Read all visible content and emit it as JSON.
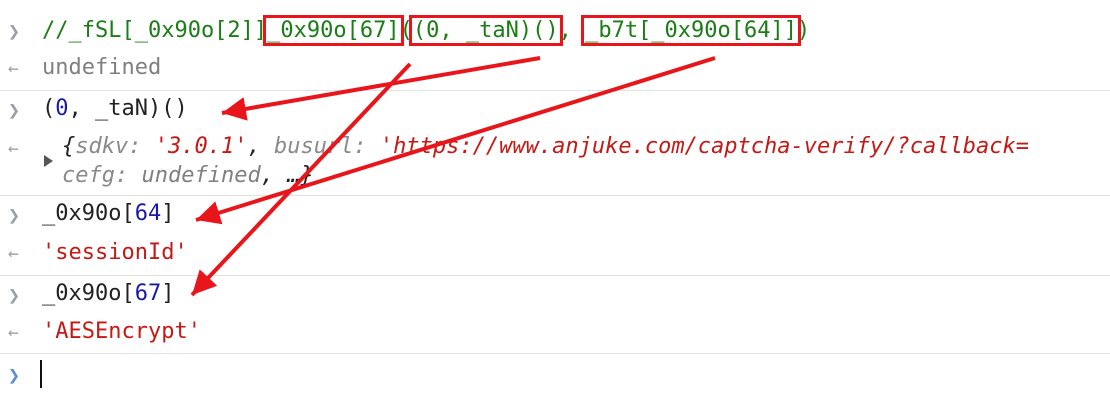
{
  "console": {
    "line1": {
      "comment_start": "//_fSL[_0x90o[2]]",
      "box1": "_0x90o[67]",
      "paren_open": "(",
      "box2": "(0, _taN)()",
      "comma": ",",
      "box3": "_b7t[_0x90o[64]]",
      "paren_close": ")"
    },
    "result1": "undefined",
    "line2": {
      "p_open": "(",
      "zero": "0",
      "rest": ", _taN)()"
    },
    "result2": {
      "open": "{",
      "k1": "sdkv:",
      "v1": "'3.0.1'",
      "sep1": ",",
      "k2": "busurl:",
      "v2": "'https://www.anjuke.com/captcha-verify/?callback=",
      "k3": "cefg:",
      "v3": "undefined",
      "tail": ", …}"
    },
    "line3": {
      "name": "_0x90o[",
      "num": "64",
      "close": "]"
    },
    "result3": "'sessionId'",
    "line4": {
      "name": "_0x90o[",
      "num": "67",
      "close": "]"
    },
    "result4": "'AESEncrypt'"
  },
  "icons": {
    "input_prompt": "chevron-right-icon",
    "output_prompt": "return-arrow-icon",
    "expand": "triangle-right-icon"
  },
  "colors": {
    "annotation": "#e8161b",
    "string": "#c41a16",
    "number": "#1a1aa6",
    "comment": "#1b7d15"
  }
}
